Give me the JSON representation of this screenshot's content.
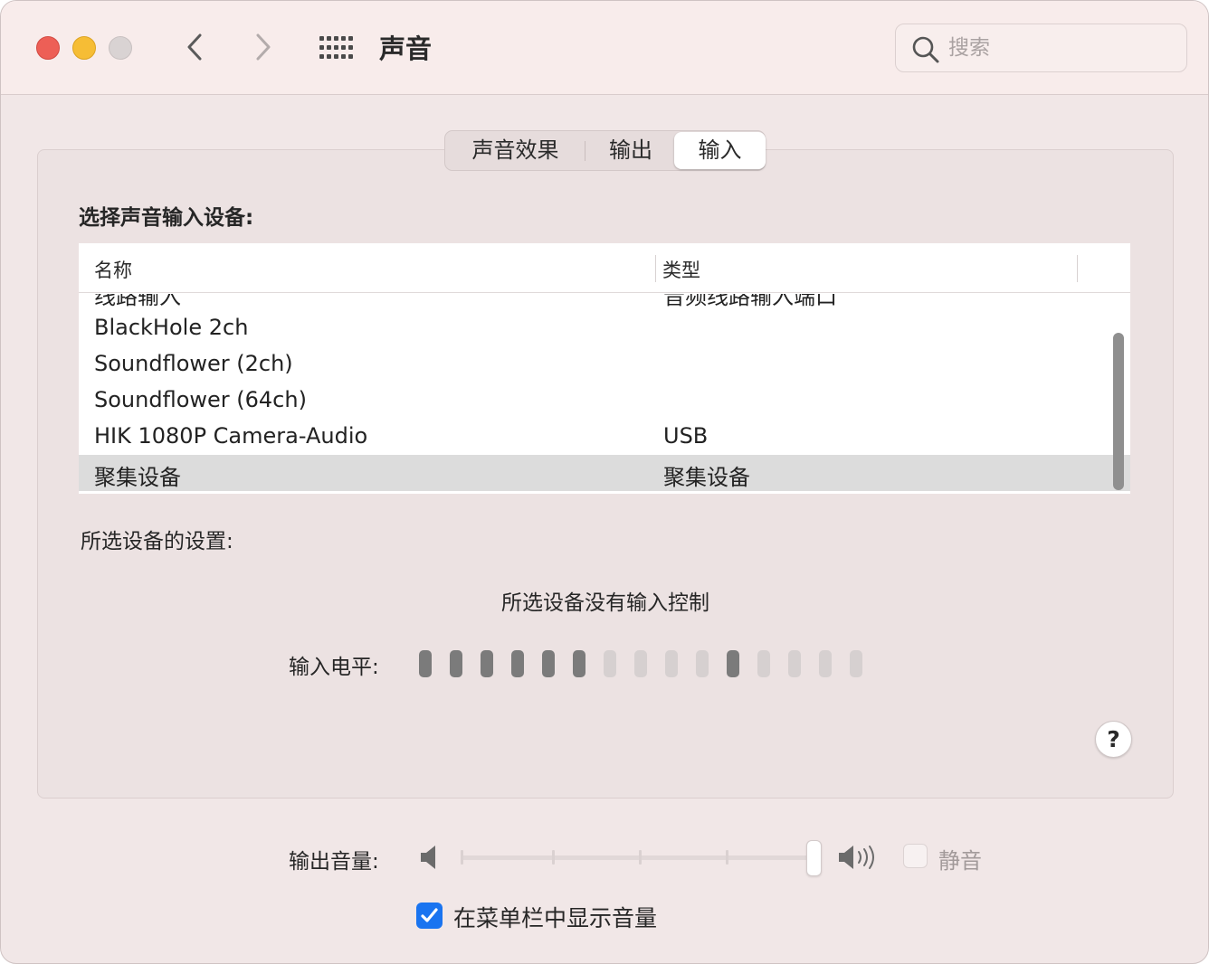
{
  "window": {
    "title": "声音"
  },
  "toolbar": {
    "back_icon": "chevron-left-icon",
    "forward_icon": "chevron-right-icon",
    "grid_icon": "grid-icon",
    "search_placeholder": "搜索"
  },
  "tabs": [
    {
      "label": "声音效果",
      "selected": false
    },
    {
      "label": "输出",
      "selected": false
    },
    {
      "label": "输入",
      "selected": true
    }
  ],
  "input": {
    "section_label": "选择声音输入设备:",
    "columns": {
      "name": "名称",
      "type": "类型"
    },
    "devices": [
      {
        "name": "线路输入",
        "type": "音频线路输入端口"
      },
      {
        "name": "BlackHole 2ch",
        "type": ""
      },
      {
        "name": "Soundflower (2ch)",
        "type": ""
      },
      {
        "name": "Soundflower (64ch)",
        "type": ""
      },
      {
        "name": "HIK 1080P Camera-Audio",
        "type": "USB"
      },
      {
        "name": "聚集设备",
        "type": "聚集设备"
      }
    ],
    "selected_device": "聚集设备",
    "settings_label": "所选设备的设置:",
    "no_control_text": "所选设备没有输入控制",
    "level_label": "输入电平:",
    "level_bars_total": 15,
    "level_bars_on": [
      1,
      2,
      3,
      4,
      5,
      6,
      11
    ]
  },
  "help": {
    "label": "?"
  },
  "output_volume": {
    "label": "输出音量:",
    "level": 1.0,
    "mute_label": "静音",
    "mute_checked": false
  },
  "menubar": {
    "label": "在菜单栏中显示音量",
    "checked": true
  },
  "colors": {
    "accent": "#1a74f0",
    "close": "#ed5f56",
    "minimize": "#f6bd35",
    "maximize": "#d9d3d3"
  }
}
